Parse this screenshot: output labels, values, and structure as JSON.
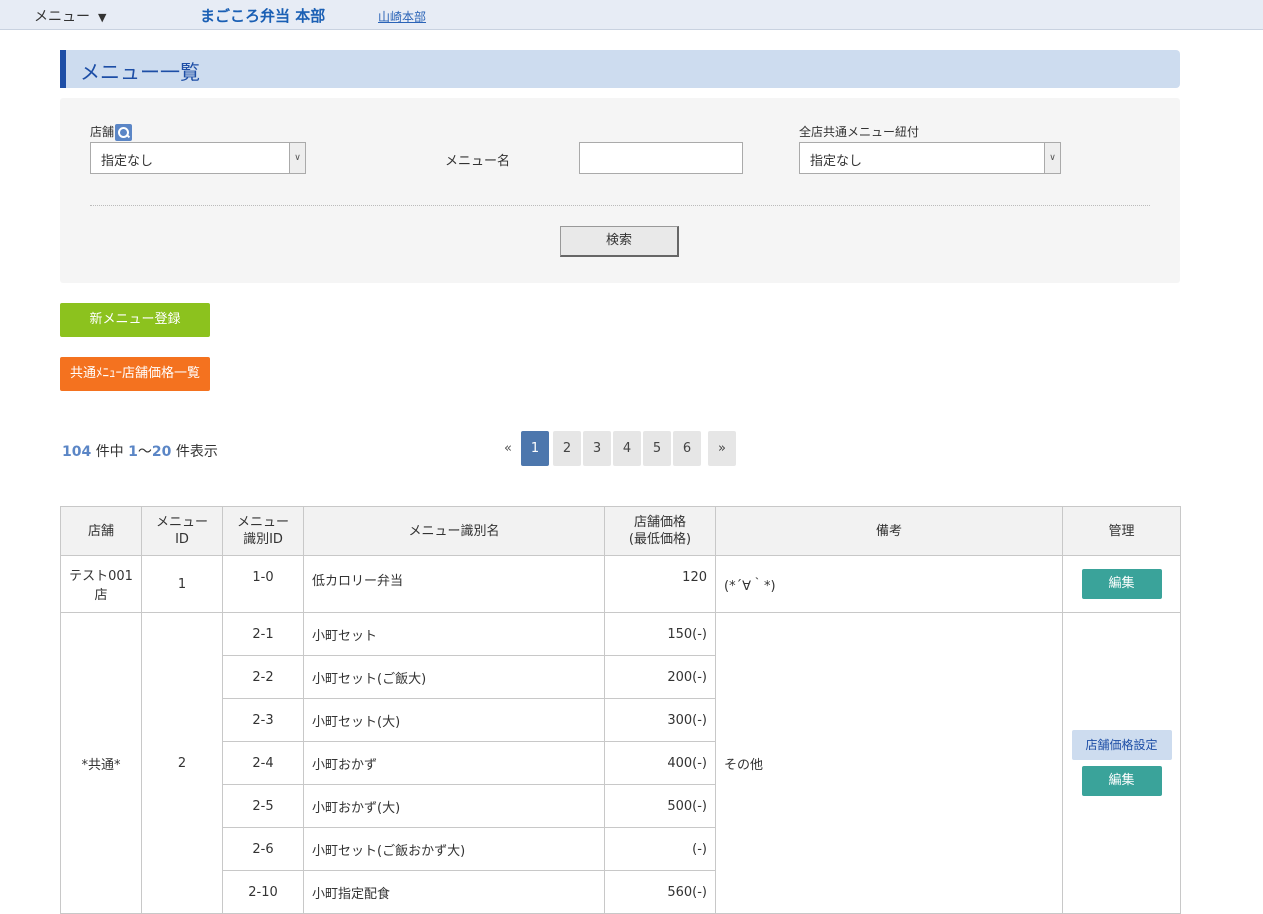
{
  "header": {
    "menu_label": "メニュー",
    "menu_arrow": "▼",
    "brand": "まごころ弁当 本部",
    "hq_link": "山崎本部"
  },
  "page_title": "メニュー一覧",
  "search": {
    "store_label": "店舗",
    "store_value": "指定なし",
    "menu_name_label": "メニュー名",
    "menu_name_value": "",
    "common_label": "全店共通メニュー紐付",
    "common_value": "指定なし",
    "search_button": "検索"
  },
  "actions": {
    "new_menu": "新メニュー登録",
    "common_price_list": "共通ﾒﾆｭｰ店舗価格一覧"
  },
  "results": {
    "total": "104",
    "text_middle": "件中",
    "range_start": "1",
    "range_sep": "〜",
    "range_end": "20",
    "text_end": "件表示"
  },
  "pagination": {
    "prev": "«",
    "pages": [
      "1",
      "2",
      "3",
      "4",
      "5",
      "6"
    ],
    "next": "»",
    "current": "1"
  },
  "table": {
    "headers": {
      "store": "店舗",
      "menu_id_1": "メニュー",
      "menu_id_2": "ID",
      "ident_id_1": "メニュー",
      "ident_id_2": "識別ID",
      "ident_name": "メニュー識別名",
      "price_1": "店舗価格",
      "price_2": "(最低価格)",
      "note": "備考",
      "manage": "管理"
    },
    "group1": {
      "store_1": "テスト001",
      "store_2": "店",
      "menu_id": "1",
      "note": "(*´∀｀*)",
      "edit": "編集",
      "rows": [
        {
          "ident_id": "1-0",
          "name": "低カロリー弁当",
          "price": "120"
        }
      ]
    },
    "group2": {
      "store": "*共通*",
      "menu_id": "2",
      "note": "その他",
      "store_price": "店舗価格設定",
      "edit": "編集",
      "rows": [
        {
          "ident_id": "2-1",
          "name": "小町セット",
          "price": "150(-)"
        },
        {
          "ident_id": "2-2",
          "name": "小町セット(ご飯大)",
          "price": "200(-)"
        },
        {
          "ident_id": "2-3",
          "name": "小町セット(大)",
          "price": "300(-)"
        },
        {
          "ident_id": "2-4",
          "name": "小町おかず",
          "price": "400(-)"
        },
        {
          "ident_id": "2-5",
          "name": "小町おかず(大)",
          "price": "500(-)"
        },
        {
          "ident_id": "2-6",
          "name": "小町セット(ご飯おかず大)",
          "price": "(-)"
        },
        {
          "ident_id": "2-10",
          "name": "小町指定配食",
          "price": "560(-)"
        }
      ]
    }
  }
}
